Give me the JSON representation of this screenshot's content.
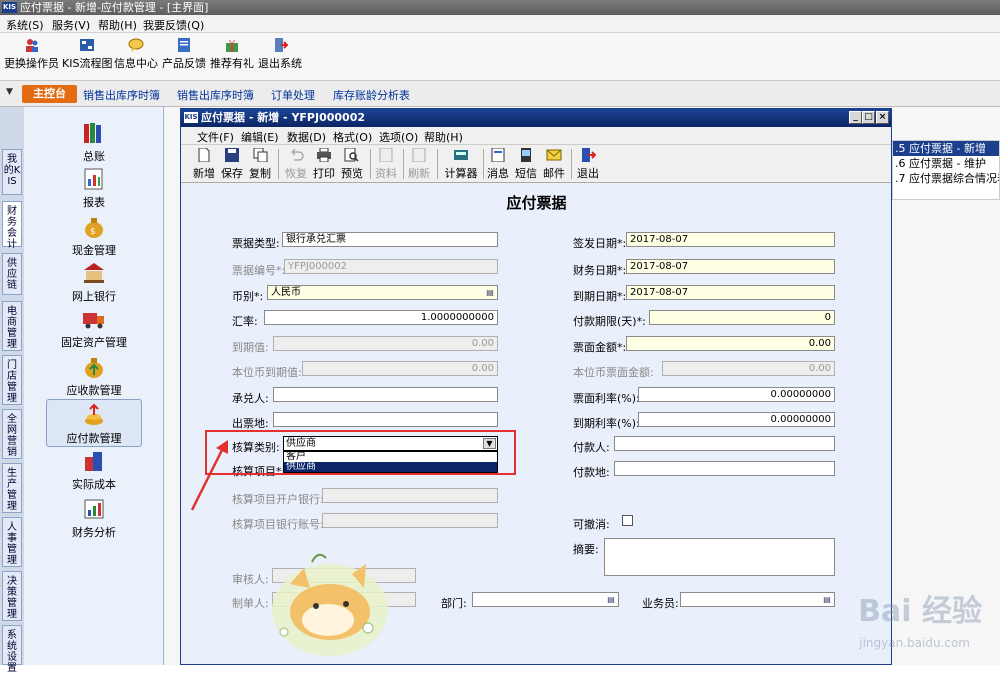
{
  "app_title": "应付票据 - 新增-应付款管理 - [主界面]",
  "menu": [
    "系统(S)",
    "服务(V)",
    "帮助(H)",
    "我要反馈(Q)"
  ],
  "toolbar": [
    "更换操作员",
    "KIS流程图",
    "信息中心",
    "产品反馈",
    "推荐有礼",
    "退出系统"
  ],
  "tabs": {
    "main": "主控台",
    "items": [
      "销售出库序时簿",
      "销售出库序时簿",
      "订单处理",
      "库存账龄分析表"
    ]
  },
  "vtabs": [
    "我的KIS",
    "财务会计",
    "供应链",
    "电商管理",
    "门店管理",
    "全网营销",
    "生产管理",
    "人事管理",
    "决策管理",
    "系统设置"
  ],
  "nav": [
    "总账",
    "报表",
    "现金管理",
    "网上银行",
    "固定资产管理",
    "应收款管理",
    "应付款管理",
    "实际成本",
    "财务分析"
  ],
  "rightlist": [
    ".5  应付票据 - 新增",
    ".6  应付票据 - 维护",
    ".7  应付票据综合情况表"
  ],
  "window": {
    "title": "应付票据 - 新增 - YFPJ000002",
    "menu": [
      "文件(F)",
      "编辑(E)",
      "数据(D)",
      "格式(O)",
      "选项(O)",
      "帮助(H)"
    ],
    "tools": [
      "新增",
      "保存",
      "复制",
      "恢复",
      "打印",
      "预览",
      "资料",
      "刷新",
      "计算器",
      "消息",
      "短信",
      "邮件",
      "退出"
    ]
  },
  "form": {
    "title": "应付票据",
    "left": [
      {
        "label": "票据类型:",
        "value": "银行承兑汇票"
      },
      {
        "label": "票据编号*:",
        "value": "YFPJ000002"
      },
      {
        "label": "币别*:",
        "value": "人民币"
      },
      {
        "label": "汇率:",
        "value": "1.0000000000"
      },
      {
        "label": "到期值:",
        "value": "0.00"
      },
      {
        "label": "本位币到期值:",
        "value": "0.00"
      },
      {
        "label": "承兑人:",
        "value": ""
      },
      {
        "label": "出票地:",
        "value": ""
      },
      {
        "label": "核算类别:",
        "value": "供应商"
      },
      {
        "label": "核算项目*:",
        "value": ""
      },
      {
        "label": "核算项目开户银行:",
        "value": ""
      },
      {
        "label": "核算项目银行账号:",
        "value": ""
      }
    ],
    "right": [
      {
        "label": "签发日期*:",
        "value": "2017-08-07"
      },
      {
        "label": "财务日期*:",
        "value": "2017-08-07"
      },
      {
        "label": "到期日期*:",
        "value": "2017-08-07"
      },
      {
        "label": "付款期限(天)*:",
        "value": "0"
      },
      {
        "label": "票面金额*:",
        "value": "0.00"
      },
      {
        "label": "本位币票面金额:",
        "value": "0.00"
      },
      {
        "label": "票面利率(%):",
        "value": "0.00000000"
      },
      {
        "label": "到期利率(%):",
        "value": "0.00000000"
      },
      {
        "label": "付款人:",
        "value": ""
      },
      {
        "label": "付款地:",
        "value": ""
      },
      {
        "label": "可撤消:",
        "value": ""
      },
      {
        "label": "摘要:",
        "value": ""
      }
    ],
    "dropdown_options": [
      "客户",
      "供应商"
    ],
    "bottom": {
      "reviewer": "审核人:",
      "maker": "制单人:",
      "dept": "部门:",
      "staff": "业务员:"
    }
  },
  "watermark": {
    "main": "Bai 经验",
    "sub": "jingyan.baidu.com"
  }
}
